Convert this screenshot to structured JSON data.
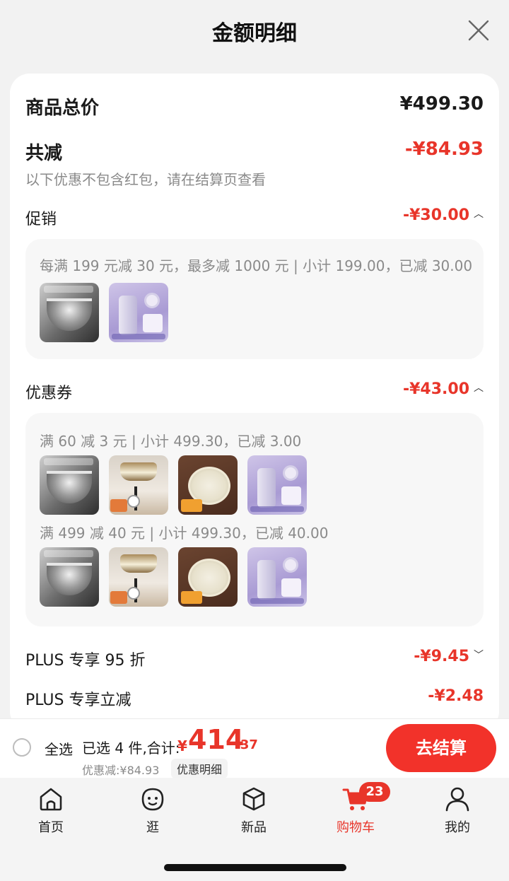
{
  "header": {
    "title": "金额明细"
  },
  "summary": {
    "goods_total_label": "商品总价",
    "goods_total_value": "¥499.30",
    "total_reduce_label": "共减",
    "total_reduce_value": "-¥84.93",
    "note": "以下优惠不包含红包，请在结算页查看"
  },
  "promotion": {
    "label": "促销",
    "value": "-¥30.00",
    "rule": "每满 199 元减 30 元，最多减 1000 元 | 小计 199.00，已减 30.00"
  },
  "coupon": {
    "label": "优惠券",
    "value": "-¥43.00",
    "rules": [
      "满 60 减 3 元 | 小计 499.30，已减 3.00",
      "满 499 减 40 元 | 小计 499.30，已减 40.00"
    ]
  },
  "plus_discount": {
    "label": "PLUS 专享 95 折",
    "value": "-¥9.45"
  },
  "plus_reduce": {
    "label": "PLUS 专享立减",
    "value": "-¥2.48"
  },
  "checkout": {
    "select_all": "全选",
    "selected": "已选 4 件,合计:",
    "currency": "¥",
    "total_int": "414",
    "total_dec": ".37",
    "discount_note": "优惠减:¥84.93",
    "detail_link": "优惠明细",
    "button": "去结算"
  },
  "tabs": [
    {
      "label": "首页",
      "icon": "home-icon"
    },
    {
      "label": "逛",
      "icon": "face-icon"
    },
    {
      "label": "新品",
      "icon": "box-icon"
    },
    {
      "label": "购物车",
      "icon": "cart-icon",
      "badge": "23",
      "active": true
    },
    {
      "label": "我的",
      "icon": "person-icon"
    }
  ],
  "colors": {
    "accent": "#e8352a",
    "checkout_button": "#f2322a"
  }
}
